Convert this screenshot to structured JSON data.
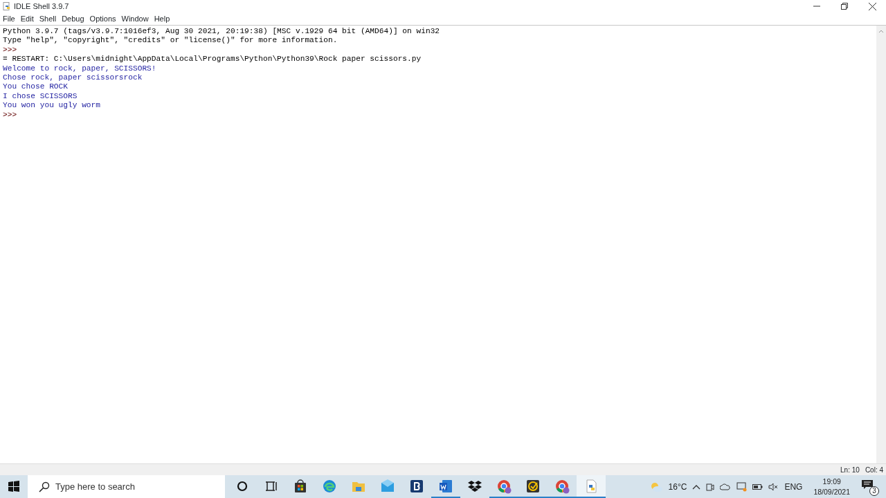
{
  "window": {
    "title": "IDLE Shell 3.9.7"
  },
  "menu": [
    "File",
    "Edit",
    "Shell",
    "Debug",
    "Options",
    "Window",
    "Help"
  ],
  "shell_lines": [
    {
      "kind": "banner",
      "text": "Python 3.9.7 (tags/v3.9.7:1016ef3, Aug 30 2021, 20:19:38) [MSC v.1929 64 bit (AMD64)] on win32"
    },
    {
      "kind": "banner",
      "text": "Type \"help\", \"copyright\", \"credits\" or \"license()\" for more information."
    },
    {
      "kind": "prompt",
      "text": ">>>"
    },
    {
      "kind": "restart",
      "text": "= RESTART: C:\\Users\\midnight\\AppData\\Local\\Programs\\Python\\Python39\\Rock paper scissors.py"
    },
    {
      "kind": "stdout",
      "text": "Welcome to rock, paper, SCISSORS!"
    },
    {
      "kind": "stdout",
      "text": "Chose rock, paper scissorsrock"
    },
    {
      "kind": "stdout",
      "text": "You chose ROCK"
    },
    {
      "kind": "stdout",
      "text": "I chose SCISSORS"
    },
    {
      "kind": "stdout",
      "text": "You won you ugly worm"
    },
    {
      "kind": "prompt",
      "text": ">>>"
    }
  ],
  "status_bar": {
    "line": "Ln: 10",
    "column": "Col: 4"
  },
  "taskbar": {
    "search": {
      "placeholder": "Type here to search"
    },
    "apps": [
      {
        "kind": "cortana",
        "running": false,
        "active": false
      },
      {
        "kind": "taskview",
        "running": false,
        "active": false
      },
      {
        "kind": "store",
        "running": false,
        "active": false
      },
      {
        "kind": "edge",
        "running": false,
        "active": false
      },
      {
        "kind": "folder",
        "running": false,
        "active": false
      },
      {
        "kind": "mail",
        "running": false,
        "active": false
      },
      {
        "kind": "b",
        "running": false,
        "active": false
      },
      {
        "kind": "word",
        "running": true,
        "active": false
      },
      {
        "kind": "dropbox",
        "running": false,
        "active": false
      },
      {
        "kind": "chrome",
        "running": true,
        "active": false
      },
      {
        "kind": "norton",
        "running": true,
        "active": false
      },
      {
        "kind": "chrome",
        "running": true,
        "active": false
      },
      {
        "kind": "python",
        "running": true,
        "active": true
      }
    ],
    "temperature": "16°C",
    "language": "ENG",
    "time": "19:09",
    "date": "18/09/2021",
    "notifications": "3"
  }
}
